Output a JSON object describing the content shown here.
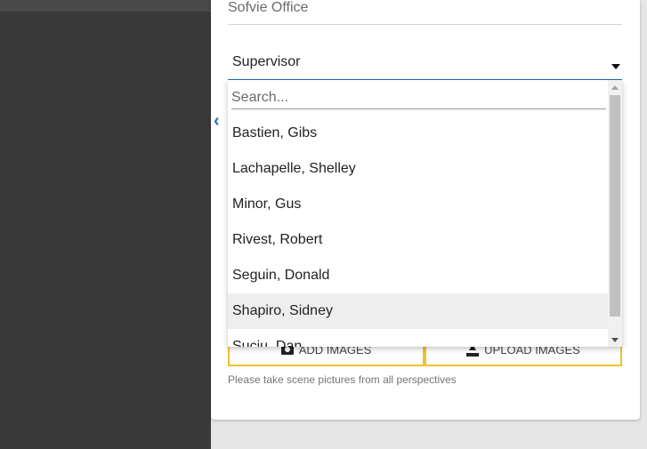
{
  "form": {
    "office_value": "Sofvie Office",
    "supervisor_value": "Supervisor",
    "add_images_label": "ADD IMAGES",
    "upload_images_label": "UPLOAD IMAGES",
    "hint_text": "Please take scene pictures from all perspectives"
  },
  "dropdown": {
    "search_placeholder": "Search...",
    "options": [
      "Bastien, Gibs",
      "Lachapelle, Shelley",
      "Minor, Gus",
      "Rivest, Robert",
      "Seguin, Donald",
      "Shapiro, Sidney",
      "Suciu, Dan"
    ],
    "highlighted_option": "Shapiro, Sidney"
  },
  "icons": {
    "chevron": "chevron-left-icon",
    "caret": "caret-down-icon",
    "add_images": "camera-icon",
    "upload_images": "upload-icon"
  },
  "colors": {
    "accent_blue": "#1f6fb5",
    "button_border": "#f2c12e",
    "highlight_bg": "#eeeeee",
    "sidebar_bg": "#393939"
  }
}
